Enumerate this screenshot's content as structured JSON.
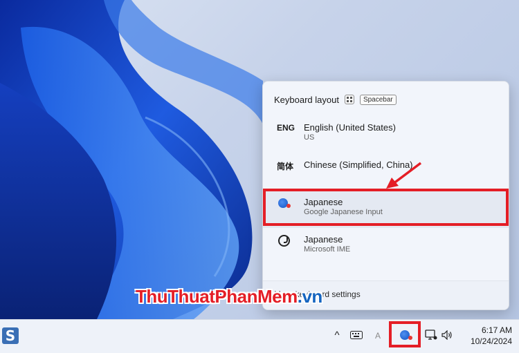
{
  "flyout": {
    "title": "Keyboard layout",
    "shortcut_key": "Spacebar",
    "items": [
      {
        "abbr": "ENG",
        "name": "English (United States)",
        "sub": "US"
      },
      {
        "abbr": "简体",
        "name": "Chinese (Simplified, China)",
        "sub": ""
      },
      {
        "icon": "google-japanese-input-icon",
        "name": "Japanese",
        "sub": "Google Japanese Input"
      },
      {
        "icon": "microsoft-ime-icon",
        "name": "Japanese",
        "sub": "Microsoft IME"
      }
    ],
    "footer_link": "More keyboard settings"
  },
  "watermark": {
    "main": "ThuThuatPhanMem",
    "suffix": ".vn"
  },
  "taskbar": {
    "tray_chevron": "^",
    "input_indicator": "A",
    "time": "6:17 AM",
    "date": "10/24/2024"
  },
  "colors": {
    "highlight": "#e41e26",
    "accent": "#2a6bd6"
  }
}
